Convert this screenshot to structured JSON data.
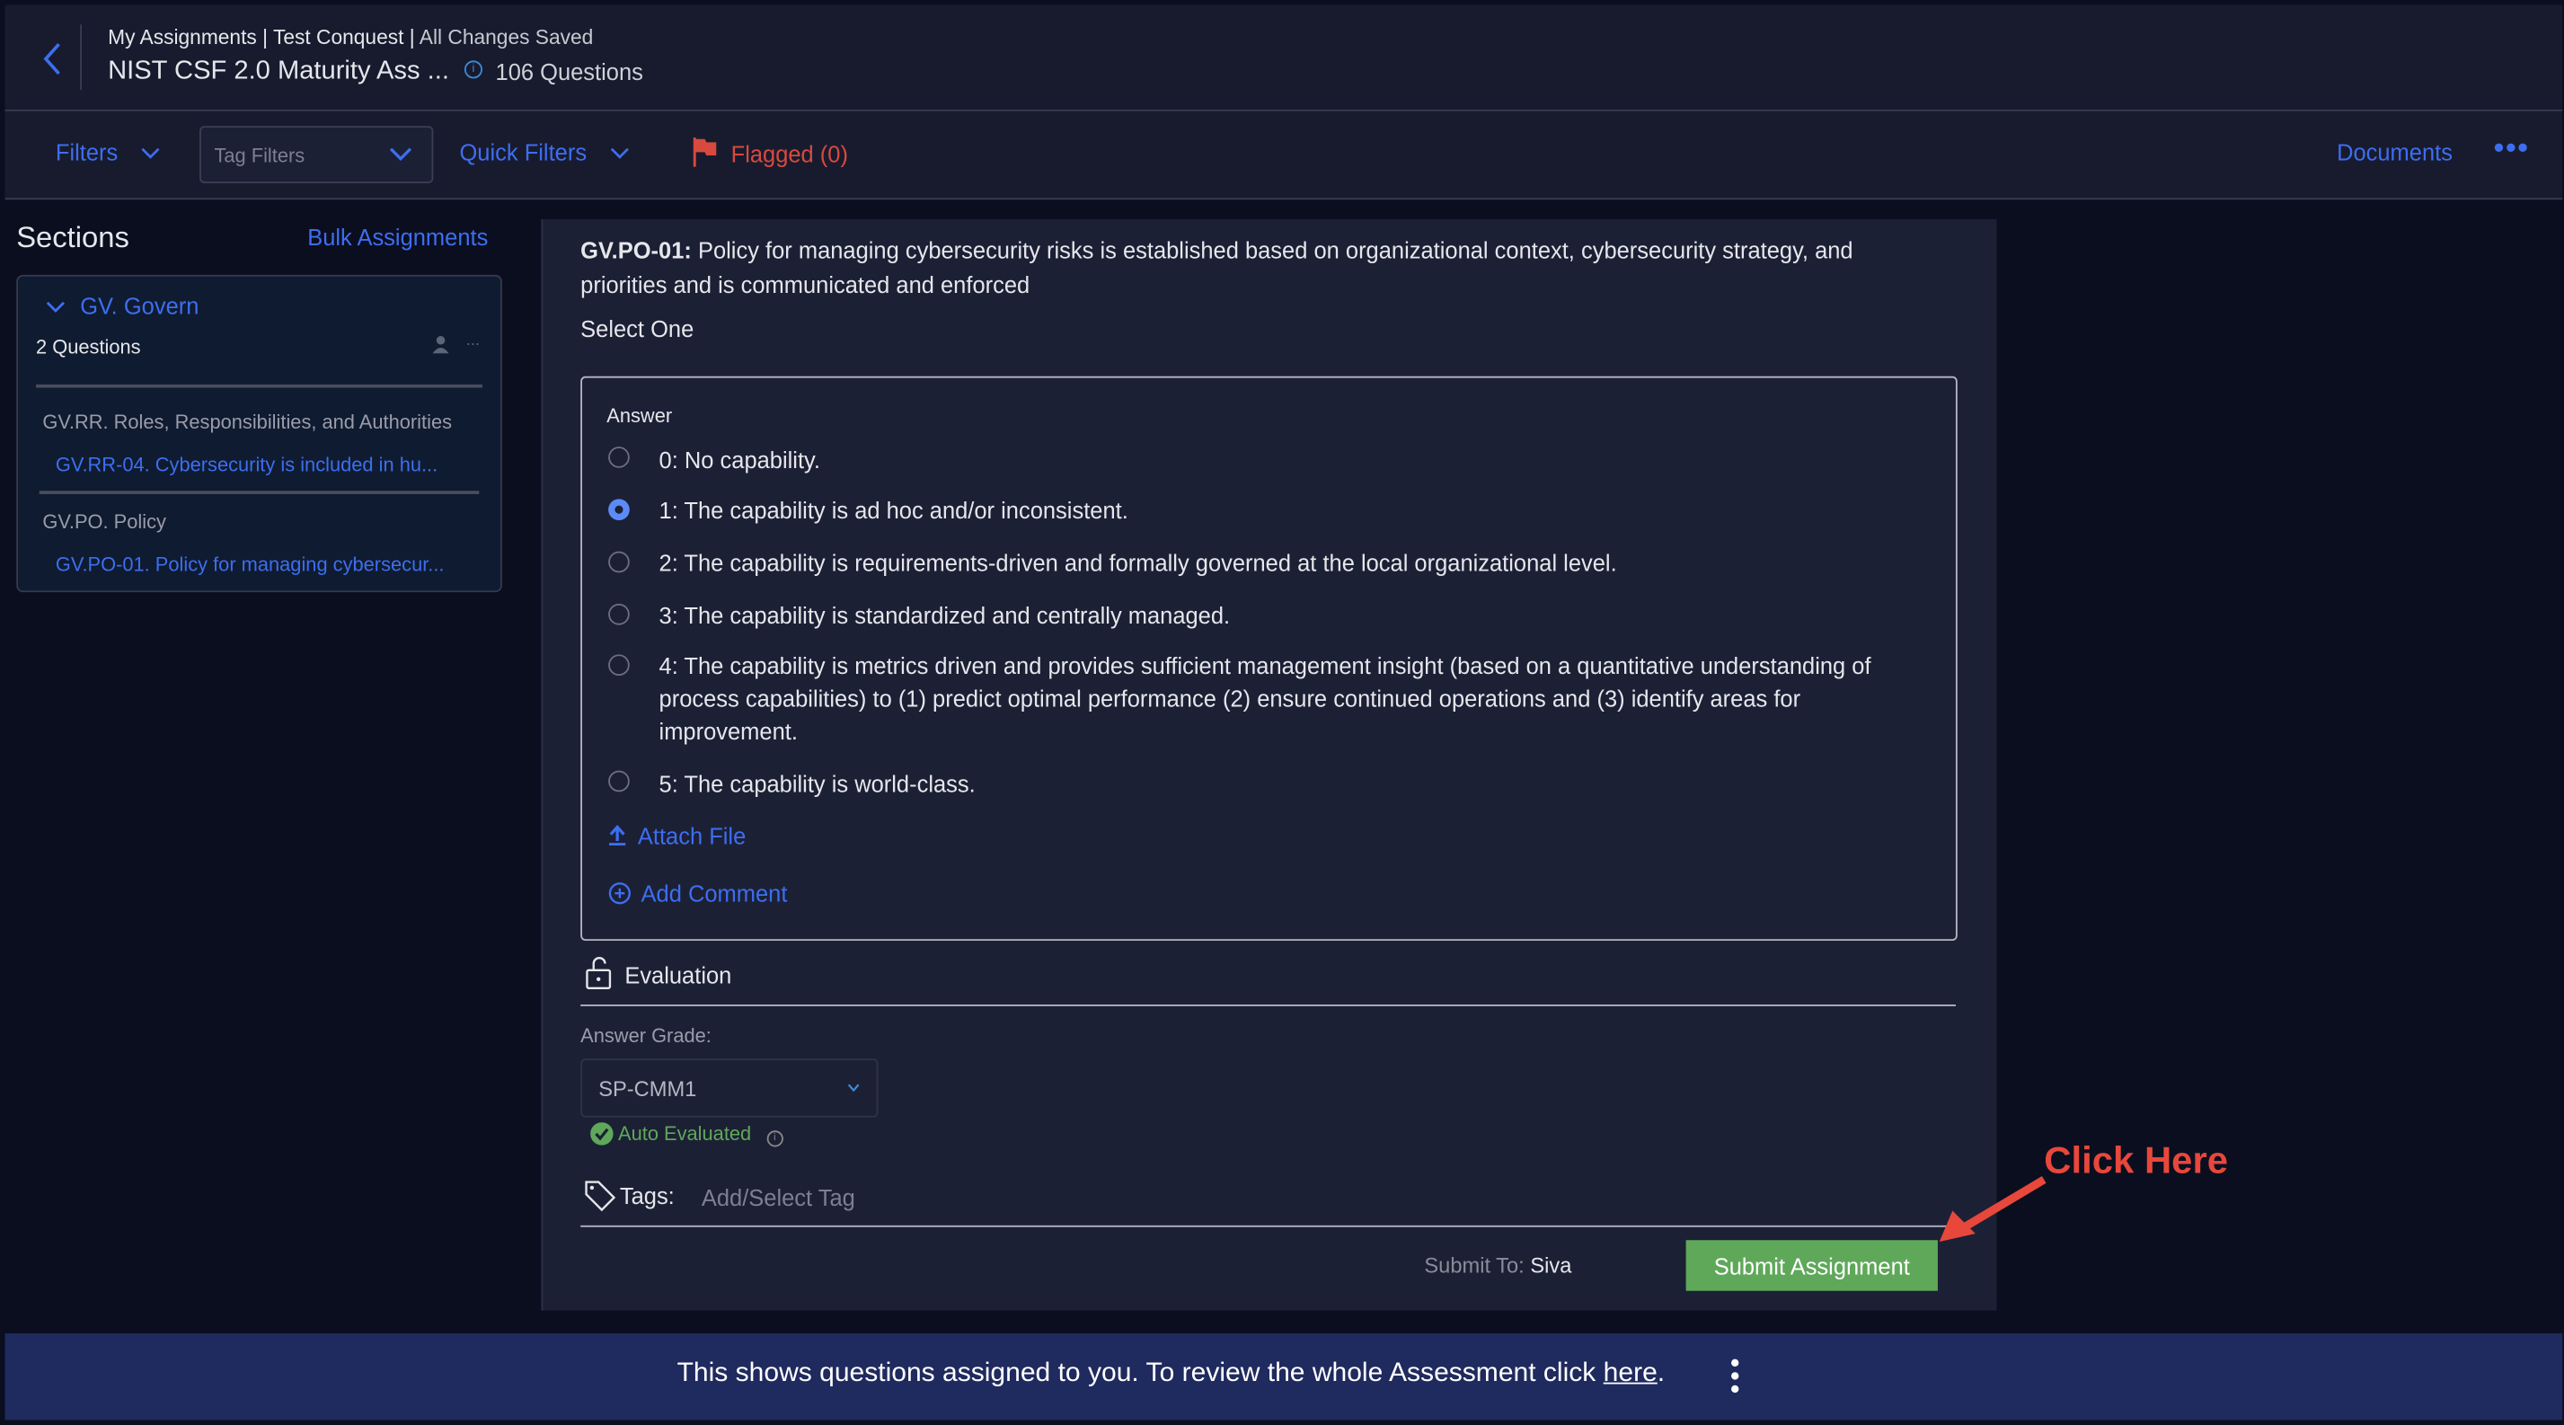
{
  "header": {
    "breadcrumb": [
      "My Assignments",
      "Test Conquest",
      "All Changes Saved"
    ],
    "separator": "|",
    "title": "NIST CSF 2.0 Maturity Ass ...",
    "question_count": "106 Questions"
  },
  "toolbar": {
    "filters": "Filters",
    "tag_filters_placeholder": "Tag Filters",
    "quick_filters": "Quick Filters",
    "flagged": "Flagged (0)",
    "documents": "Documents",
    "flag_color": "#d84a3e"
  },
  "sidebar": {
    "title": "Sections",
    "bulk_assignments": "Bulk Assignments",
    "section": {
      "name": "GV. Govern",
      "count": "2 Questions",
      "groups": [
        {
          "name": "GV.RR. Roles, Responsibilities, and Authorities",
          "item": "GV.RR-04. Cybersecurity is included in hu..."
        },
        {
          "name": "GV.PO. Policy",
          "item": "GV.PO-01. Policy for managing cybersecur..."
        }
      ]
    }
  },
  "question": {
    "id": "GV.PO-01:",
    "text": " Policy for managing cybersecurity risks is established based on organizational context, cybersecurity strategy, and priorities and is communicated and enforced",
    "instruction": "Select One",
    "answer_label": "Answer",
    "options": [
      "0: No capability.",
      "1: The capability is ad hoc and/or inconsistent.",
      "2: The capability is requirements-driven and formally governed at the local organizational level.",
      "3: The capability is standardized and centrally managed.",
      "4: The capability is metrics driven and provides sufficient management insight (based on a quantitative understanding of process capabilities) to (1) predict optimal performance (2) ensure continued operations and (3) identify areas for improvement.",
      "5: The capability is world-class."
    ],
    "selected_index": 1,
    "attach_file": "Attach File",
    "add_comment": "Add Comment"
  },
  "evaluation": {
    "title": "Evaluation",
    "grade_label": "Answer Grade:",
    "grade_value": "SP-CMM1",
    "auto_evaluated": "Auto Evaluated",
    "tags_label": "Tags:",
    "tags_placeholder": "Add/Select Tag",
    "submit_to_label": "Submit To:",
    "submit_to_name": "Siva",
    "submit_button": "Submit Assignment"
  },
  "annotation": {
    "text": "Click Here",
    "color": "#e8473b"
  },
  "banner": {
    "text": "This shows questions assigned to you. To review the whole Assessment click ",
    "link": "here",
    "suffix": "."
  }
}
